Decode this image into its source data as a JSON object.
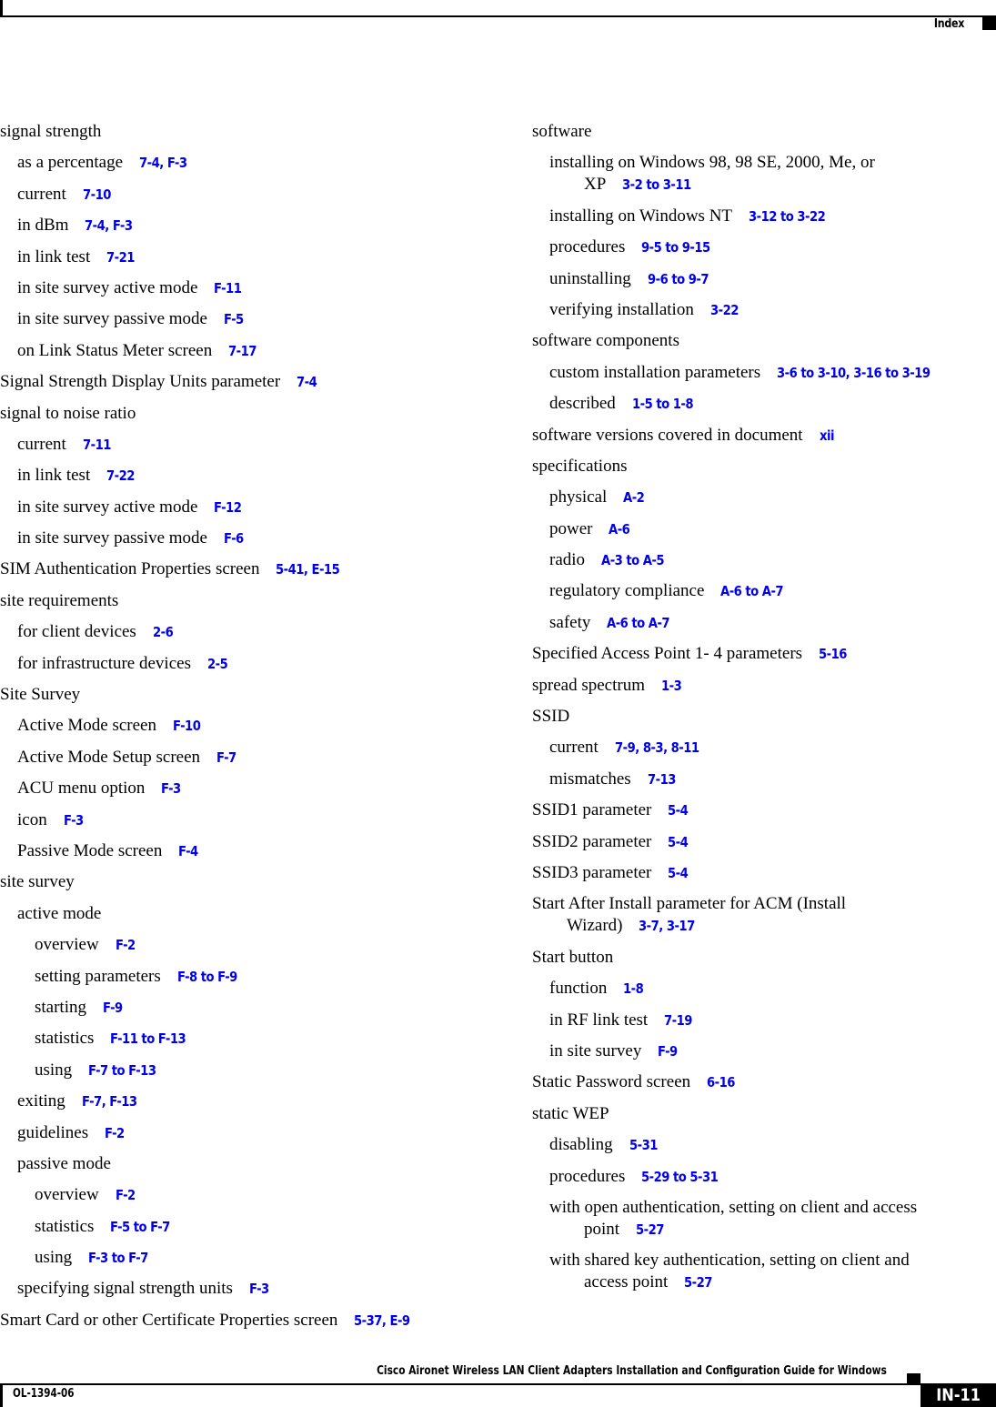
{
  "header": {
    "section_title": "Index"
  },
  "footer": {
    "guide_title": "Cisco Aironet Wireless LAN Client Adapters Installation and Configuration Guide for Windows",
    "doc_code": "OL-1394-06",
    "page_number": "IN-11"
  },
  "colors": {
    "link": "#0000ee",
    "text": "#000000"
  },
  "left_column": [
    {
      "level": 0,
      "term": "signal strength",
      "refs": ""
    },
    {
      "level": 1,
      "term": "as a percentage",
      "refs": "7-4, F-3"
    },
    {
      "level": 1,
      "term": "current",
      "refs": "7-10"
    },
    {
      "level": 1,
      "term": "in dBm",
      "refs": "7-4, F-3"
    },
    {
      "level": 1,
      "term": "in link test",
      "refs": "7-21"
    },
    {
      "level": 1,
      "term": "in site survey active mode",
      "refs": "F-11"
    },
    {
      "level": 1,
      "term": "in site survey passive mode",
      "refs": "F-5"
    },
    {
      "level": 1,
      "term": "on Link Status Meter screen",
      "refs": "7-17"
    },
    {
      "level": 0,
      "term": "Signal Strength Display Units parameter",
      "refs": "7-4"
    },
    {
      "level": 0,
      "term": "signal to noise ratio",
      "refs": ""
    },
    {
      "level": 1,
      "term": "current",
      "refs": "7-11"
    },
    {
      "level": 1,
      "term": "in link test",
      "refs": "7-22"
    },
    {
      "level": 1,
      "term": "in site survey active mode",
      "refs": "F-12"
    },
    {
      "level": 1,
      "term": "in site survey passive mode",
      "refs": "F-6"
    },
    {
      "level": 0,
      "term": "SIM Authentication Properties screen",
      "refs": "5-41, E-15"
    },
    {
      "level": 0,
      "term": "site requirements",
      "refs": ""
    },
    {
      "level": 1,
      "term": "for client devices",
      "refs": "2-6"
    },
    {
      "level": 1,
      "term": "for infrastructure devices",
      "refs": "2-5"
    },
    {
      "level": 0,
      "term": "Site Survey",
      "refs": ""
    },
    {
      "level": 1,
      "term": "Active Mode screen",
      "refs": "F-10"
    },
    {
      "level": 1,
      "term": "Active Mode Setup screen",
      "refs": "F-7"
    },
    {
      "level": 1,
      "term": "ACU menu option",
      "refs": "F-3"
    },
    {
      "level": 1,
      "term": "icon",
      "refs": "F-3"
    },
    {
      "level": 1,
      "term": "Passive Mode screen",
      "refs": "F-4"
    },
    {
      "level": 0,
      "term": "site survey",
      "refs": ""
    },
    {
      "level": 1,
      "term": "active mode",
      "refs": ""
    },
    {
      "level": 2,
      "term": "overview",
      "refs": "F-2"
    },
    {
      "level": 2,
      "term": "setting parameters",
      "refs": "F-8 to F-9"
    },
    {
      "level": 2,
      "term": "starting",
      "refs": "F-9"
    },
    {
      "level": 2,
      "term": "statistics",
      "refs": "F-11 to F-13"
    },
    {
      "level": 2,
      "term": "using",
      "refs": "F-7 to F-13"
    },
    {
      "level": 1,
      "term": "exiting",
      "refs": "F-7, F-13"
    },
    {
      "level": 1,
      "term": "guidelines",
      "refs": "F-2"
    },
    {
      "level": 1,
      "term": "passive mode",
      "refs": ""
    },
    {
      "level": 2,
      "term": "overview",
      "refs": "F-2"
    },
    {
      "level": 2,
      "term": "statistics",
      "refs": "F-5 to F-7"
    },
    {
      "level": 2,
      "term": "using",
      "refs": "F-3 to F-7"
    },
    {
      "level": 1,
      "term": "specifying signal strength units",
      "refs": "F-3"
    },
    {
      "level": 0,
      "term": "Smart Card or other Certificate Properties screen",
      "refs": "5-37, E-9"
    }
  ],
  "right_column": [
    {
      "level": 0,
      "term": "software",
      "refs": ""
    },
    {
      "level": 1,
      "term": "installing on Windows 98, 98 SE, 2000, Me, or",
      "cont": "XP",
      "refs": "3-2 to 3-11"
    },
    {
      "level": 1,
      "term": "installing on Windows NT",
      "refs": "3-12 to 3-22"
    },
    {
      "level": 1,
      "term": "procedures",
      "refs": "9-5 to 9-15"
    },
    {
      "level": 1,
      "term": "uninstalling",
      "refs": "9-6 to 9-7"
    },
    {
      "level": 1,
      "term": "verifying installation",
      "refs": "3-22"
    },
    {
      "level": 0,
      "term": "software components",
      "refs": ""
    },
    {
      "level": 1,
      "term": "custom installation parameters",
      "refs": "3-6 to 3-10, 3-16 to 3-19"
    },
    {
      "level": 1,
      "term": "described",
      "refs": "1-5 to 1-8"
    },
    {
      "level": 0,
      "term": "software versions covered in document",
      "refs": "xii"
    },
    {
      "level": 0,
      "term": "specifications",
      "refs": ""
    },
    {
      "level": 1,
      "term": "physical",
      "refs": "A-2"
    },
    {
      "level": 1,
      "term": "power",
      "refs": "A-6"
    },
    {
      "level": 1,
      "term": "radio",
      "refs": "A-3 to A-5"
    },
    {
      "level": 1,
      "term": "regulatory compliance",
      "refs": "A-6 to A-7"
    },
    {
      "level": 1,
      "term": "safety",
      "refs": "A-6 to A-7"
    },
    {
      "level": 0,
      "term": "Specified Access Point 1- 4 parameters",
      "refs": "5-16"
    },
    {
      "level": 0,
      "term": "spread spectrum",
      "refs": "1-3"
    },
    {
      "level": 0,
      "term": "SSID",
      "refs": ""
    },
    {
      "level": 1,
      "term": "current",
      "refs": "7-9, 8-3, 8-11"
    },
    {
      "level": 1,
      "term": "mismatches",
      "refs": "7-13"
    },
    {
      "level": 0,
      "term": "SSID1 parameter",
      "refs": "5-4"
    },
    {
      "level": 0,
      "term": "SSID2 parameter",
      "refs": "5-4"
    },
    {
      "level": 0,
      "term": "SSID3 parameter",
      "refs": "5-4"
    },
    {
      "level": 0,
      "term": "Start After Install parameter for ACM (Install",
      "cont": "Wizard)",
      "refs": "3-7, 3-17"
    },
    {
      "level": 0,
      "term": "Start button",
      "refs": ""
    },
    {
      "level": 1,
      "term": "function",
      "refs": "1-8"
    },
    {
      "level": 1,
      "term": "in RF link test",
      "refs": "7-19"
    },
    {
      "level": 1,
      "term": "in site survey",
      "refs": "F-9"
    },
    {
      "level": 0,
      "term": "Static Password screen",
      "refs": "6-16"
    },
    {
      "level": 0,
      "term": "static WEP",
      "refs": ""
    },
    {
      "level": 1,
      "term": "disabling",
      "refs": "5-31"
    },
    {
      "level": 1,
      "term": "procedures",
      "refs": "5-29 to 5-31"
    },
    {
      "level": 1,
      "term": "with open authentication, setting on client and access",
      "cont": "point",
      "refs": "5-27"
    },
    {
      "level": 1,
      "term": "with shared key authentication, setting on client and",
      "cont": "access point",
      "refs": "5-27"
    }
  ]
}
